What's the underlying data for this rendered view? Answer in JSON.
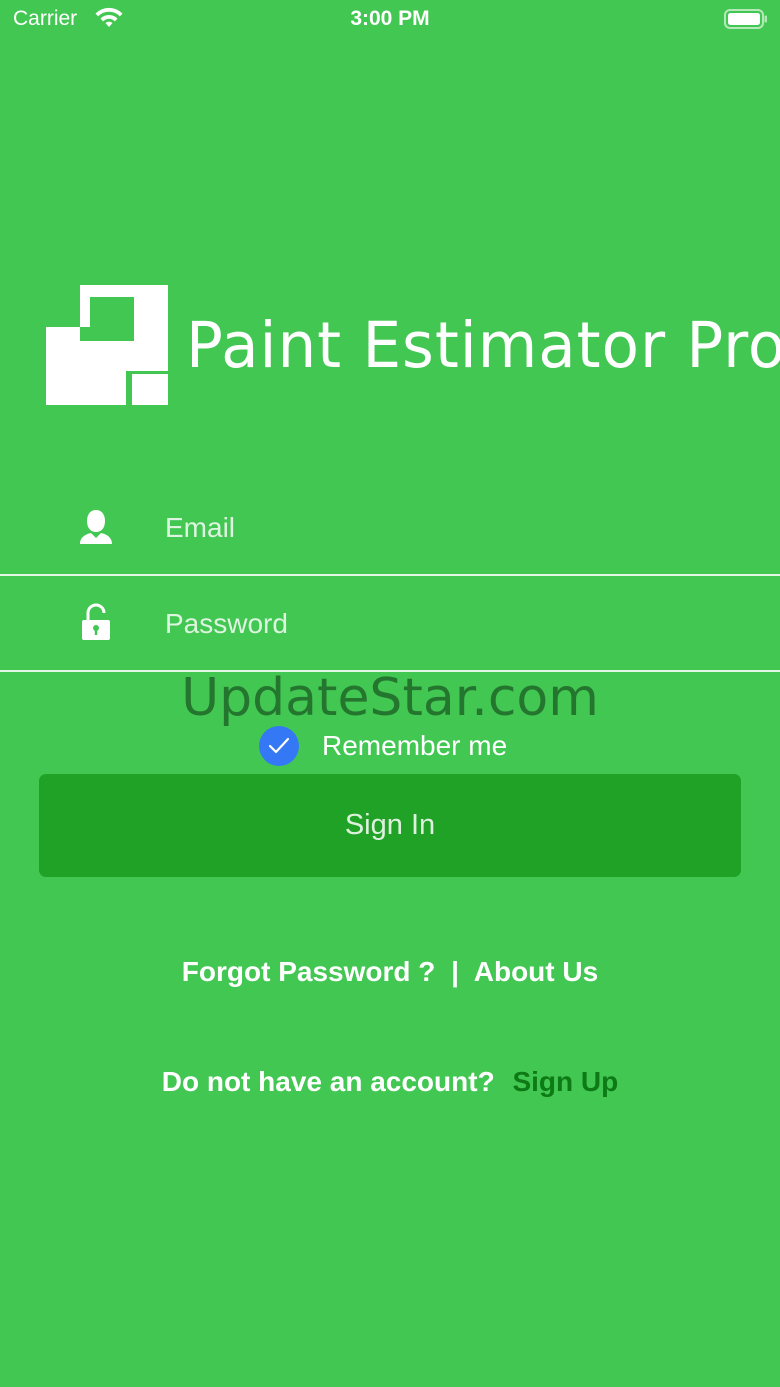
{
  "status_bar": {
    "carrier": "Carrier",
    "time": "3:00 PM",
    "icons": [
      "wifi-icon",
      "battery-icon"
    ]
  },
  "app": {
    "title": "Paint Estimator Pro",
    "logo_icon": "paint-estimator-logo-icon"
  },
  "form": {
    "email_placeholder": "Email",
    "email_icon": "user-icon",
    "password_placeholder": "Password",
    "password_icon": "unlock-icon",
    "remember_label": "Remember me",
    "remember_checked": true,
    "signin_label": "Sign In"
  },
  "watermark": "UpdateStar.com",
  "links": {
    "forgot_password": "Forgot Password ?",
    "separator": "|",
    "about_us": "About Us"
  },
  "signup": {
    "prompt": "Do not have an account?",
    "link": "Sign Up"
  },
  "colors": {
    "background": "#42c752",
    "button": "#20a227",
    "checkbox": "#3478f6",
    "signup_link": "#0d7a15"
  }
}
